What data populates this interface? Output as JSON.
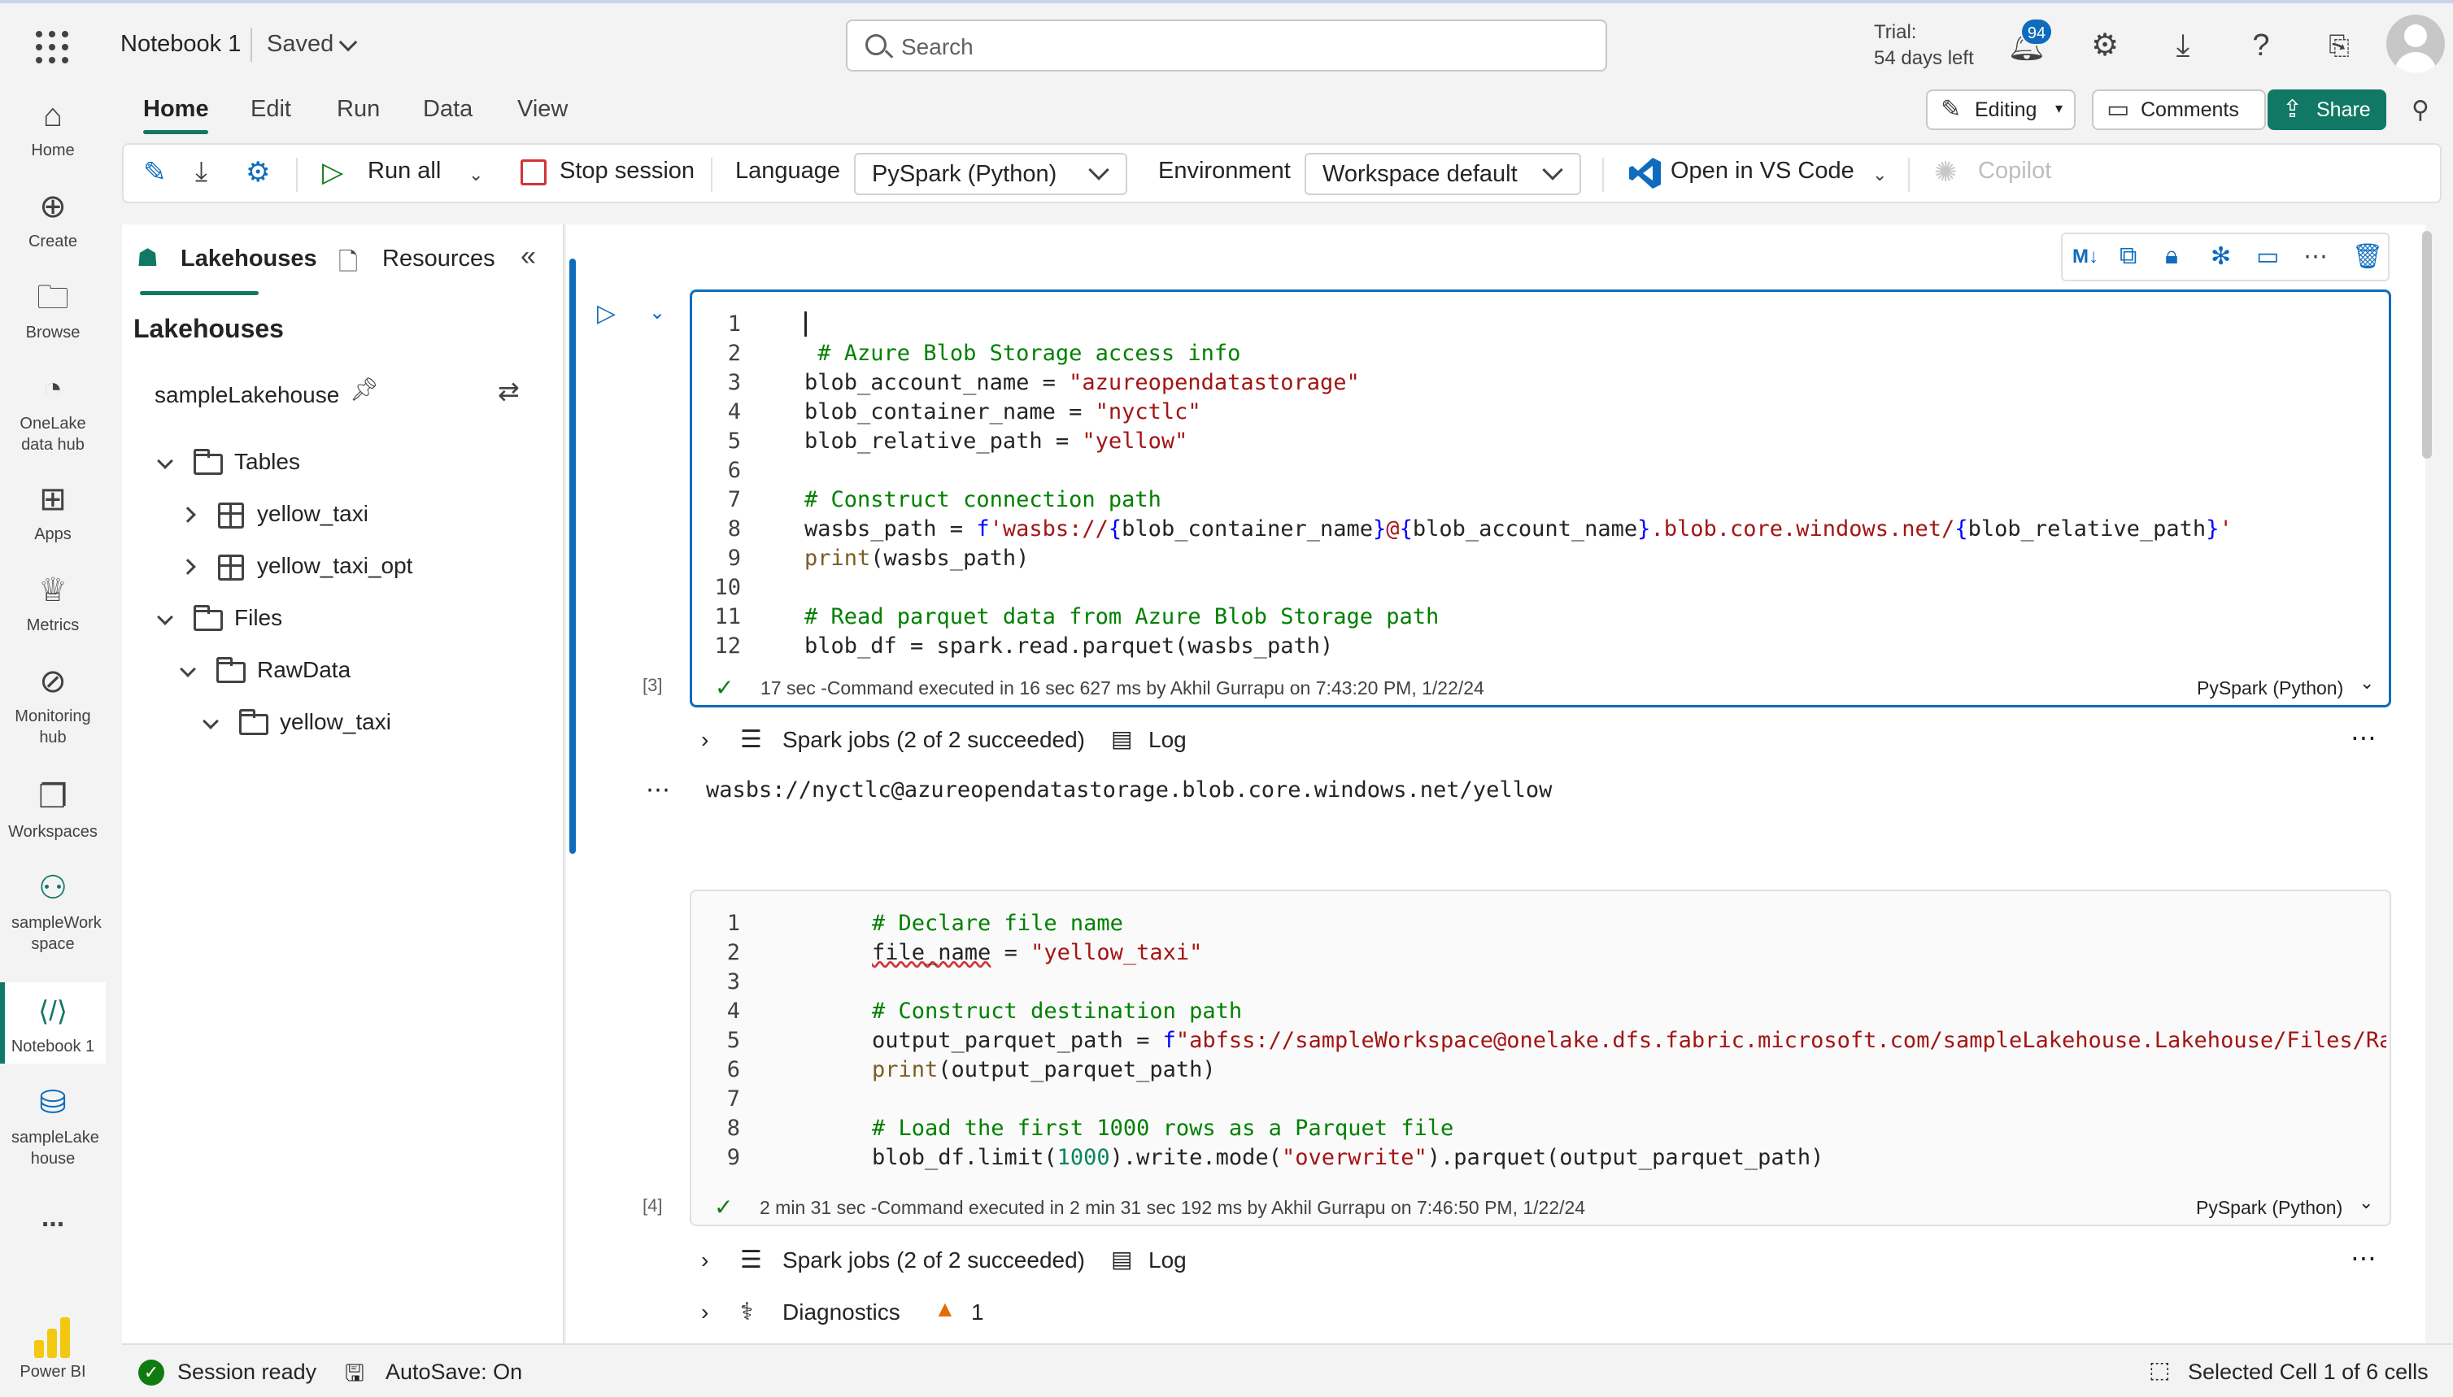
{
  "topbar": {
    "notebook_title": "Notebook 1",
    "save_state": "Saved",
    "search_placeholder": "Search",
    "trial_line1": "Trial:",
    "trial_line2": "54 days left",
    "notification_count": "94"
  },
  "leftnav": {
    "items": [
      {
        "label": "Home",
        "icon": "home-icon"
      },
      {
        "label": "Create",
        "icon": "plus-circle-icon"
      },
      {
        "label": "Browse",
        "icon": "folder-icon"
      },
      {
        "label": "OneLake data hub",
        "icon": "onelake-icon"
      },
      {
        "label": "Apps",
        "icon": "apps-icon"
      },
      {
        "label": "Metrics",
        "icon": "trophy-icon"
      },
      {
        "label": "Monitoring hub",
        "icon": "monitoring-icon"
      },
      {
        "label": "Workspaces",
        "icon": "workspaces-icon"
      },
      {
        "label": "sampleWork space",
        "icon": "workspace-people-icon"
      },
      {
        "label": "Notebook 1",
        "icon": "notebook-icon"
      },
      {
        "label": "sampleLake house",
        "icon": "lakehouse-icon"
      }
    ],
    "more": "...",
    "powerbi_label": "Power BI"
  },
  "ribbon": {
    "tabs": [
      "Home",
      "Edit",
      "Run",
      "Data",
      "View"
    ],
    "editing": "Editing",
    "comments": "Comments",
    "share": "Share"
  },
  "toolbar": {
    "run_all": "Run all",
    "stop_session": "Stop session",
    "language_label": "Language",
    "language_value": "PySpark (Python)",
    "environment_label": "Environment",
    "environment_value": "Workspace default",
    "open_vscode": "Open in VS Code",
    "copilot": "Copilot"
  },
  "lakepanel": {
    "tab_lakehouses": "Lakehouses",
    "tab_resources": "Resources",
    "title": "Lakehouses",
    "lakehouse_name": "sampleLakehouse",
    "tables_label": "Tables",
    "table1": "yellow_taxi",
    "table2": "yellow_taxi_opt",
    "files_label": "Files",
    "rawdata": "RawData",
    "subfolder": "yellow_taxi"
  },
  "cell1": {
    "exec_number": "[3]",
    "exec_info": "17 sec -Command executed in 16 sec 627 ms by Akhil Gurrapu on 7:43:20 PM, 1/22/24",
    "language": "PySpark (Python)",
    "spark_jobs": "Spark jobs (2 of 2 succeeded)",
    "log": "Log",
    "output": "wasbs://nyctlc@azureopendatastorage.blob.core.windows.net/yellow",
    "line_numbers": [
      "1",
      "2",
      "3",
      "4",
      "5",
      "6",
      "7",
      "8",
      "9",
      "10",
      "11",
      "12"
    ]
  },
  "cell2": {
    "exec_number": "[4]",
    "exec_info": "2 min 31 sec -Command executed in 2 min 31 sec 192 ms by Akhil Gurrapu on 7:46:50 PM, 1/22/24",
    "language": "PySpark (Python)",
    "spark_jobs": "Spark jobs (2 of 2 succeeded)",
    "log": "Log",
    "diagnostics": "Diagnostics",
    "warning_count": "1",
    "line_numbers": [
      "1",
      "2",
      "3",
      "4",
      "5",
      "6",
      "7",
      "8",
      "9"
    ]
  },
  "statusbar": {
    "session": "Session ready",
    "autosave": "AutoSave: On",
    "selected": "Selected Cell 1 of 6 cells"
  },
  "colors": {
    "accent": "#117865",
    "selection": "#0f6cbd",
    "comment": "#008000",
    "string": "#a31515"
  }
}
